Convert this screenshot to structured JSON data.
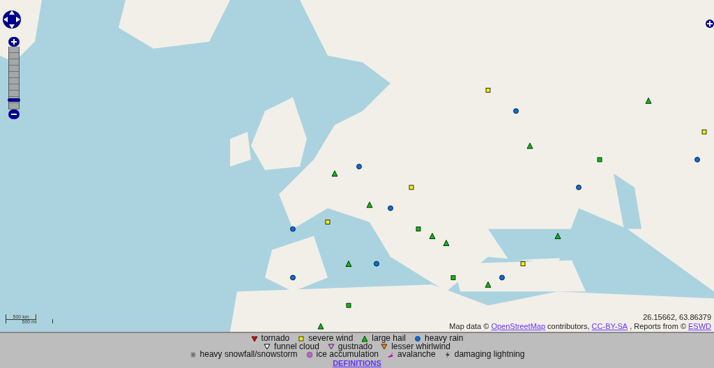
{
  "zoom": {
    "level": 0.12
  },
  "scale": {
    "metric": "500 km",
    "imperial": "500 mi"
  },
  "coordinates": "26.15662, 63.86379",
  "attribution": {
    "prefix": "Map data ©",
    "osm_link": "OpenStreetMap",
    "middle": "contributors,",
    "license_link": "CC-BY-SA",
    "reports": ", Reports from ©",
    "source_link": "ESWD"
  },
  "legend": {
    "rows": [
      [
        {
          "label": "tornado",
          "kind": "tri-down",
          "color": "#e00000"
        },
        {
          "label": "severe wind",
          "kind": "square",
          "color": "#f0f000"
        },
        {
          "label": "large hail",
          "kind": "tri-up",
          "color": "#00c000"
        },
        {
          "label": "heavy rain",
          "kind": "circle",
          "color": "#0070e0"
        }
      ],
      [
        {
          "label": "funnel cloud",
          "kind": "tri-outline",
          "color": "#ffffff"
        },
        {
          "label": "gustnado",
          "kind": "tri-down",
          "color": "#f080f0"
        },
        {
          "label": "lesser whirlwind",
          "kind": "tri-down",
          "color": "#f08000"
        }
      ],
      [
        {
          "label": "heavy snowfall/snowstorm",
          "kind": "snow",
          "color": "#707070"
        },
        {
          "label": "ice accumulation",
          "kind": "ice",
          "color": "#c060c0"
        },
        {
          "label": "avalanche",
          "kind": "avalanche",
          "color": "#c000c0"
        },
        {
          "label": "damaging lightning",
          "kind": "bolt",
          "color": "#404040"
        }
      ]
    ],
    "definitions_link": "DEFINITIONS"
  }
}
